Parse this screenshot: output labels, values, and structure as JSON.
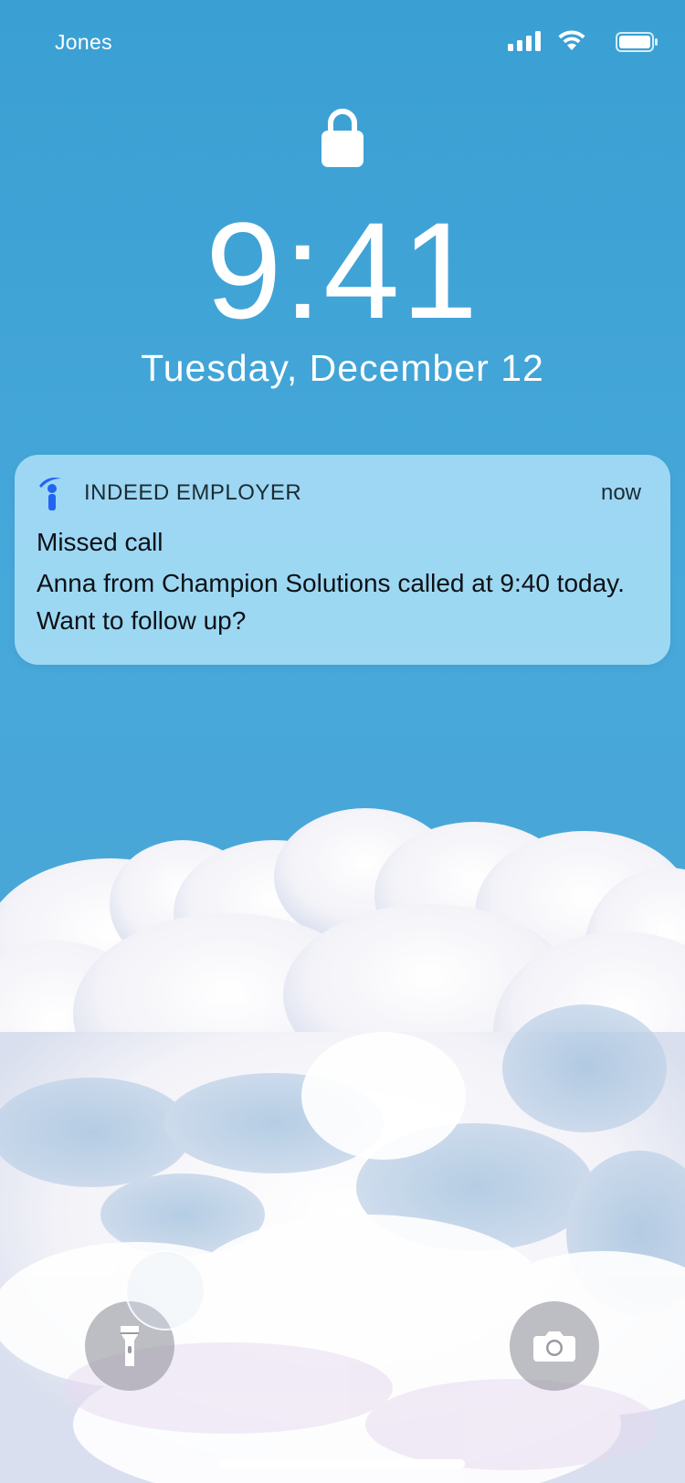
{
  "status_bar": {
    "carrier": "Jones",
    "signal_icon": "cellular-signal-icon",
    "wifi_icon": "wifi-icon",
    "battery_icon": "battery-icon"
  },
  "lock_screen": {
    "lock_icon": "lock-icon",
    "time": "9:41",
    "date": "Tuesday, December 12"
  },
  "notification": {
    "app_icon": "indeed-icon",
    "app_name": "INDEED EMPLOYER",
    "time": "now",
    "title": "Missed call",
    "body": "Anna from Champion Solutions called at 9:40 today. Want to follow up?"
  },
  "controls": {
    "flashlight_icon": "flashlight-icon",
    "camera_icon": "camera-icon"
  },
  "colors": {
    "sky": "#47a8da",
    "notification_bg": "#aadef6",
    "text_light": "#ffffff",
    "text_dark": "#0d1115",
    "indeed_blue": "#2164f3"
  }
}
